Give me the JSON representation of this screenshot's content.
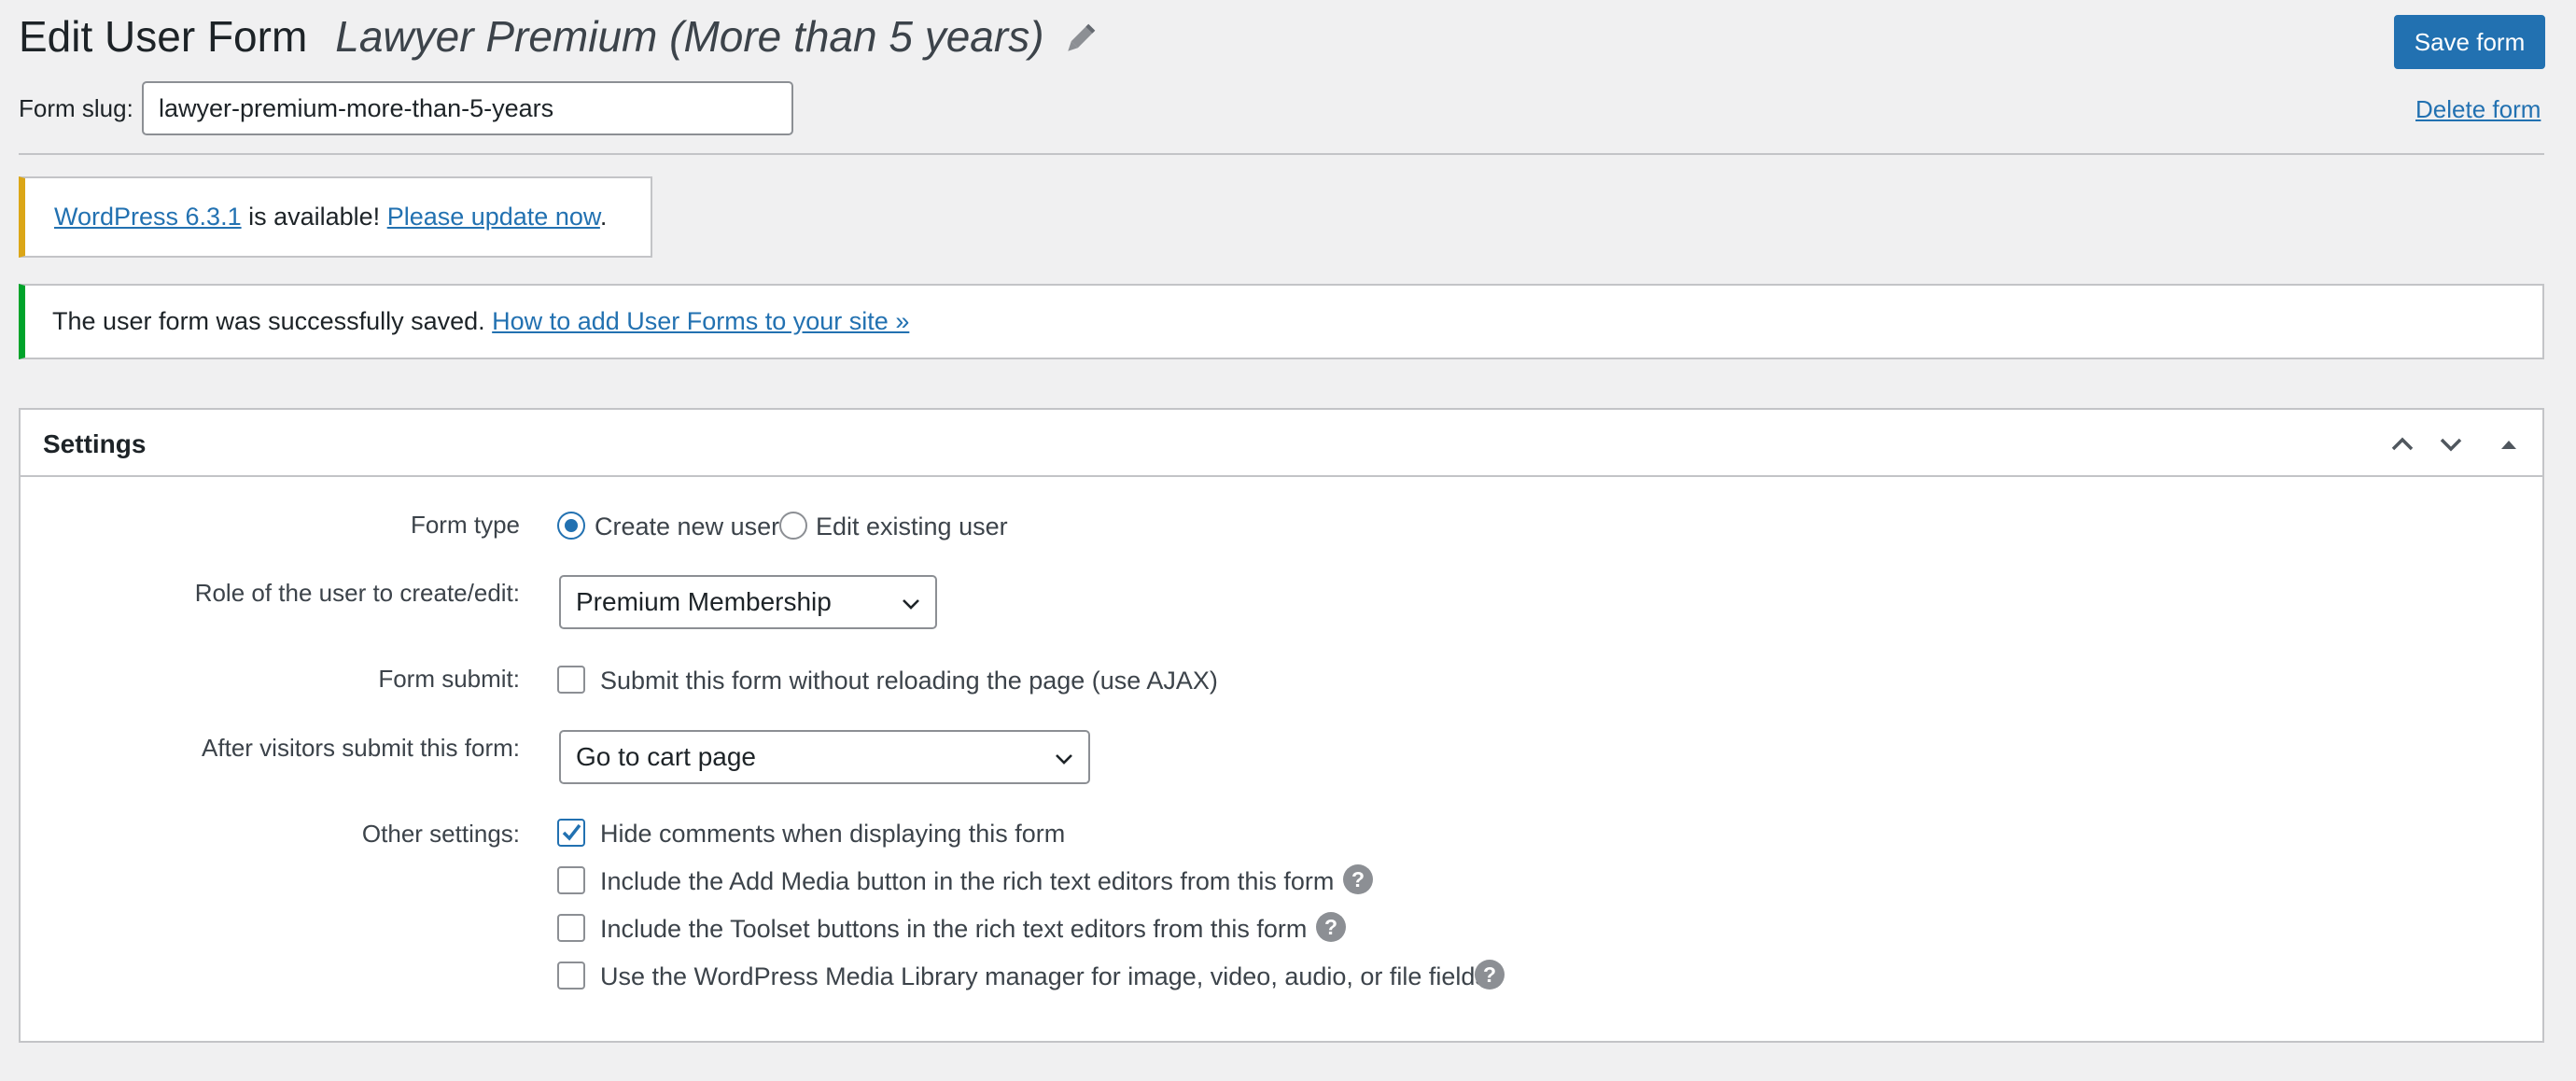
{
  "header": {
    "title": "Edit User Form",
    "form_name": "Lawyer Premium (More than 5 years)",
    "save_label": "Save form",
    "slug_label": "Form slug:",
    "slug_value": "lawyer-premium-more-than-5-years",
    "delete_label": "Delete form"
  },
  "notices": {
    "update": {
      "version_link": "WordPress 6.3.1",
      "middle_text": " is available! ",
      "update_link": "Please update now",
      "end_text": "."
    },
    "success": {
      "text": "The user form was successfully saved. ",
      "link": "How to add User Forms to your site »"
    }
  },
  "settings": {
    "title": "Settings",
    "form_type": {
      "label": "Form type",
      "options": [
        {
          "label": "Create new user",
          "checked": true
        },
        {
          "label": "Edit existing user",
          "checked": false
        }
      ]
    },
    "role": {
      "label": "Role of the user to create/edit:",
      "selected": "Premium Membership"
    },
    "form_submit": {
      "label": "Form submit:",
      "checkbox_label": "Submit this form without reloading the page (use AJAX)",
      "checked": false
    },
    "after_submit": {
      "label": "After visitors submit this form:",
      "selected": "Go to cart page"
    },
    "other": {
      "label": "Other settings:",
      "items": [
        {
          "label": "Hide comments when displaying this form",
          "checked": true,
          "help": false
        },
        {
          "label": "Include the Add Media button in the rich text editors from this form",
          "checked": false,
          "help": true
        },
        {
          "label": "Include the Toolset buttons in the rich text editors from this form",
          "checked": false,
          "help": true
        },
        {
          "label": "Use the WordPress Media Library manager for image, video, audio, or file fields",
          "checked": false,
          "help": true
        }
      ]
    },
    "help_glyph": "?"
  },
  "colors": {
    "accent": "#2271b1",
    "warning": "#dba617",
    "success": "#00a32a"
  },
  "icons": [
    "pencil-icon",
    "chevron-up-icon",
    "chevron-down-icon",
    "triangle-up-icon",
    "check-icon",
    "help-icon"
  ]
}
